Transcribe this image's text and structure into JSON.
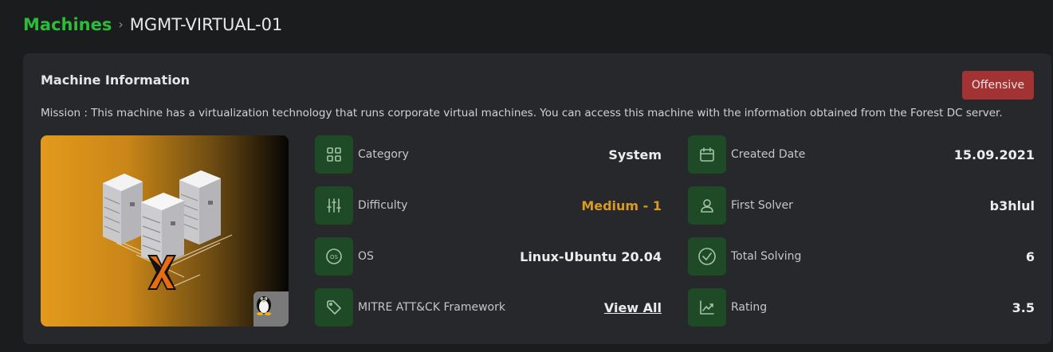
{
  "breadcrumb": {
    "parent": "Machines",
    "separator": "›",
    "current": "MGMT-VIRTUAL-01"
  },
  "card": {
    "title": "Machine Information",
    "badge": "Offensive",
    "mission": "Mission : This machine has a virtualization technology that runs corporate virtual machines. You can access this machine with the information obtained from the Forest DC server."
  },
  "image": {
    "os_icon": "linux-tux-icon"
  },
  "left_details": [
    {
      "icon": "grid-icon",
      "label": "Category",
      "value": "System"
    },
    {
      "icon": "sliders-icon",
      "label": "Difficulty",
      "value": "Medium - 1"
    },
    {
      "icon": "os-icon",
      "label": "OS",
      "value": "Linux-Ubuntu 20.04"
    },
    {
      "icon": "tag-icon",
      "label": "MITRE ATT&CK Framework",
      "value": "View All"
    }
  ],
  "right_details": [
    {
      "icon": "calendar-icon",
      "label": "Created Date",
      "value": "15.09.2021"
    },
    {
      "icon": "user-icon",
      "label": "First Solver",
      "value": "b3hlul"
    },
    {
      "icon": "check-circle-icon",
      "label": "Total Solving",
      "value": "6"
    },
    {
      "icon": "trend-chart-icon",
      "label": "Rating",
      "value": "3.5"
    }
  ],
  "colors": {
    "accent_green": "#2dbb3a",
    "badge_red": "#a33232",
    "medium_orange": "#d99a24",
    "icon_bg": "#1f4a26"
  }
}
